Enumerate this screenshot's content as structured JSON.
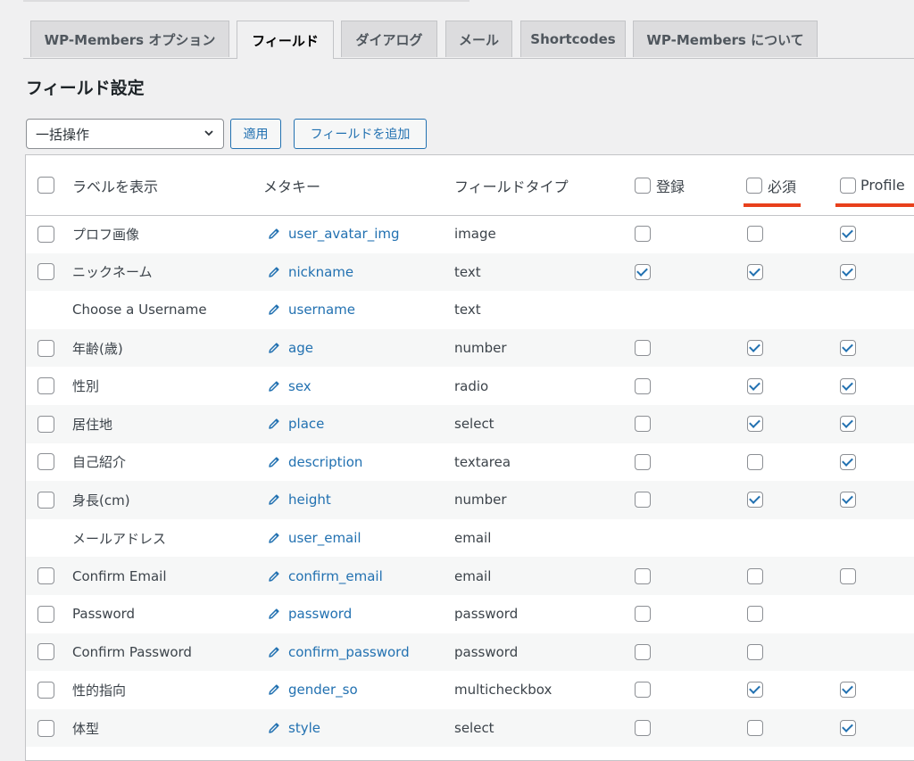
{
  "tabs": [
    {
      "label": "WP-Members オプション",
      "active": false
    },
    {
      "label": "フィールド",
      "active": true
    },
    {
      "label": "ダイアログ",
      "active": false
    },
    {
      "label": "メール",
      "active": false
    },
    {
      "label": "Shortcodes",
      "active": false
    },
    {
      "label": "WP-Members について",
      "active": false
    }
  ],
  "page_title": "フィールド設定",
  "bulk": {
    "select_value": "一括操作",
    "apply_label": "適用",
    "add_field_label": "フィールドを追加"
  },
  "table": {
    "headers": {
      "label": "ラベルを表示",
      "meta_key": "メタキー",
      "field_type": "フィールドタイプ",
      "register": "登録",
      "required": "必須",
      "profile": "Profile"
    },
    "rows": [
      {
        "label": "プロフ画像",
        "meta": "user_avatar_img",
        "type": "image",
        "select": true,
        "register": false,
        "required": false,
        "profile": true
      },
      {
        "label": "ニックネーム",
        "meta": "nickname",
        "type": "text",
        "select": true,
        "register": true,
        "required": true,
        "profile": true
      },
      {
        "label": "Choose a Username",
        "meta": "username",
        "type": "text",
        "select": null,
        "register": null,
        "required": null,
        "profile": null
      },
      {
        "label": "年齢(歳)",
        "meta": "age",
        "type": "number",
        "select": true,
        "register": false,
        "required": true,
        "profile": true
      },
      {
        "label": "性別",
        "meta": "sex",
        "type": "radio",
        "select": true,
        "register": false,
        "required": true,
        "profile": true
      },
      {
        "label": "居住地",
        "meta": "place",
        "type": "select",
        "select": true,
        "register": false,
        "required": true,
        "profile": true
      },
      {
        "label": "自己紹介",
        "meta": "description",
        "type": "textarea",
        "select": true,
        "register": false,
        "required": false,
        "profile": true
      },
      {
        "label": "身長(cm)",
        "meta": "height",
        "type": "number",
        "select": true,
        "register": false,
        "required": true,
        "profile": true
      },
      {
        "label": "メールアドレス",
        "meta": "user_email",
        "type": "email",
        "select": null,
        "register": null,
        "required": null,
        "profile": null
      },
      {
        "label": "Confirm Email",
        "meta": "confirm_email",
        "type": "email",
        "select": true,
        "register": false,
        "required": false,
        "profile": false
      },
      {
        "label": "Password",
        "meta": "password",
        "type": "password",
        "select": true,
        "register": false,
        "required": false,
        "profile": null
      },
      {
        "label": "Confirm Password",
        "meta": "confirm_password",
        "type": "password",
        "select": true,
        "register": false,
        "required": false,
        "profile": null
      },
      {
        "label": "性的指向",
        "meta": "gender_so",
        "type": "multicheckbox",
        "select": true,
        "register": false,
        "required": true,
        "profile": true
      },
      {
        "label": "体型",
        "meta": "style",
        "type": "select",
        "select": true,
        "register": false,
        "required": false,
        "profile": true
      }
    ]
  },
  "colors": {
    "link": "#2271b1",
    "highlight": "#e8401c",
    "alt_row": "#f6f7f7"
  },
  "icons": {
    "edit": "pencil-icon",
    "dropdown": "chevron-down-icon"
  }
}
